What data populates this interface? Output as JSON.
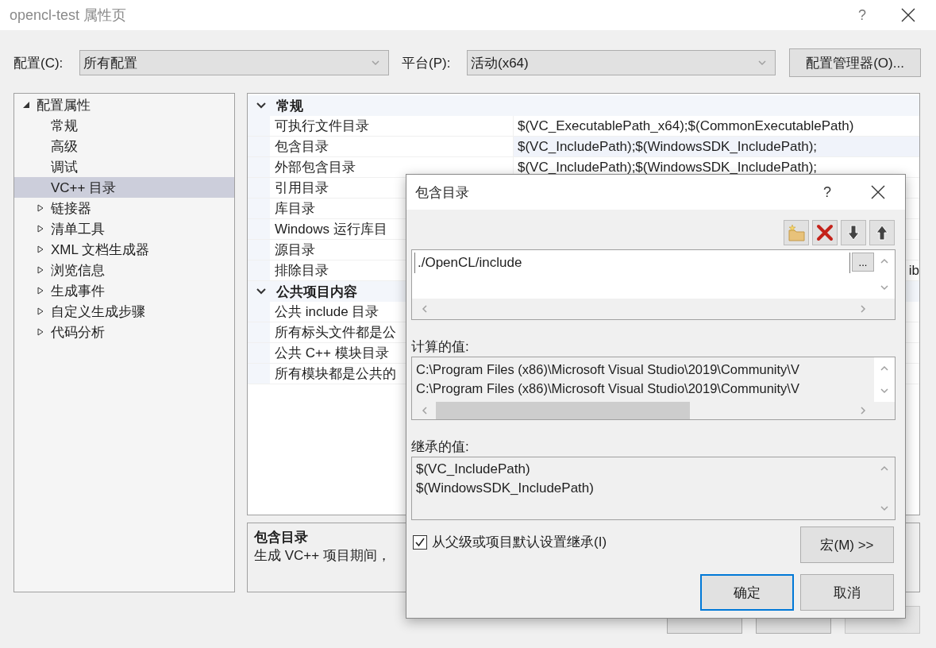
{
  "window": {
    "title": "opencl-test 属性页",
    "help": "?"
  },
  "config": {
    "label": "配置(C):",
    "value": "所有配置"
  },
  "platform": {
    "label": "平台(P):",
    "value": "活动(x64)"
  },
  "config_manager_button": "配置管理器(O)...",
  "tree": [
    {
      "label": "配置属性",
      "kind": "folder",
      "expanded": true,
      "selected": false,
      "children": [
        {
          "label": "常规",
          "kind": "leaf",
          "selected": false
        },
        {
          "label": "高级",
          "kind": "leaf",
          "selected": false
        },
        {
          "label": "调试",
          "kind": "leaf",
          "selected": false
        },
        {
          "label": "VC++ 目录",
          "kind": "leaf",
          "selected": true
        },
        {
          "label": "链接器",
          "kind": "folder",
          "expanded": false,
          "selected": false
        },
        {
          "label": "清单工具",
          "kind": "folder",
          "expanded": false,
          "selected": false
        },
        {
          "label": "XML 文档生成器",
          "kind": "folder",
          "expanded": false,
          "selected": false
        },
        {
          "label": "浏览信息",
          "kind": "folder",
          "expanded": false,
          "selected": false
        },
        {
          "label": "生成事件",
          "kind": "folder",
          "expanded": false,
          "selected": false
        },
        {
          "label": "自定义生成步骤",
          "kind": "folder",
          "expanded": false,
          "selected": false
        },
        {
          "label": "代码分析",
          "kind": "folder",
          "expanded": false,
          "selected": false
        }
      ]
    }
  ],
  "grid": {
    "sections": [
      {
        "title": "常规",
        "expanded": true,
        "rows": [
          {
            "name": "可执行文件目录",
            "value": "$(VC_ExecutablePath_x64);$(CommonExecutablePath)",
            "selected": false
          },
          {
            "name": "包含目录",
            "value": "$(VC_IncludePath);$(WindowsSDK_IncludePath);",
            "selected": true
          },
          {
            "name": "外部包含目录",
            "value": "$(VC_IncludePath);$(WindowsSDK_IncludePath);",
            "selected": false
          },
          {
            "name": "引用目录",
            "selected": false
          },
          {
            "name": "库目录",
            "selected": false
          },
          {
            "name": "Windows 运行库目",
            "selected": false
          },
          {
            "name": "源目录",
            "selected": false
          },
          {
            "name": "排除目录",
            "value": "ib",
            "kind": "overflow",
            "selected": false
          }
        ]
      },
      {
        "title": "公共项目内容",
        "expanded": true,
        "rows": [
          {
            "name": "公共 include 目录",
            "selected": false
          },
          {
            "name": "所有标头文件都是公",
            "selected": false
          },
          {
            "name": "公共 C++ 模块目录",
            "selected": false
          },
          {
            "name": "所有模块都是公共的",
            "selected": false
          }
        ]
      }
    ]
  },
  "description": {
    "title": "包含目录",
    "text": "生成 VC++ 项目期间，"
  },
  "buttons": [
    {
      "disabled": false
    },
    {
      "disabled": false
    },
    {
      "disabled": true
    }
  ],
  "dialog": {
    "title": "包含目录",
    "help": "?",
    "toolbar": [
      {
        "kind": "new-folder"
      },
      {
        "kind": "delete"
      },
      {
        "kind": "move-down"
      },
      {
        "kind": "move-up"
      }
    ],
    "entries": [
      {
        "value": "./OpenCL/include",
        "editing": true
      }
    ],
    "browse_button": "...",
    "evaluated": {
      "label": "计算的值:",
      "lines": [
        "C:\\Program Files (x86)\\Microsoft Visual Studio\\2019\\Community\\V",
        "C:\\Program Files (x86)\\Microsoft Visual Studio\\2019\\Community\\V"
      ]
    },
    "inherited": {
      "label": "继承的值:",
      "lines": [
        "$(VC_IncludePath)",
        "$(WindowsSDK_IncludePath)"
      ]
    },
    "inherit_checkbox": {
      "label": "从父级或项目默认设置继承(I)",
      "checked": true
    },
    "macros_button": "宏(M) >>",
    "buttons": [
      {
        "label": "确定",
        "default": true
      },
      {
        "label": "取消",
        "default": false
      }
    ]
  }
}
